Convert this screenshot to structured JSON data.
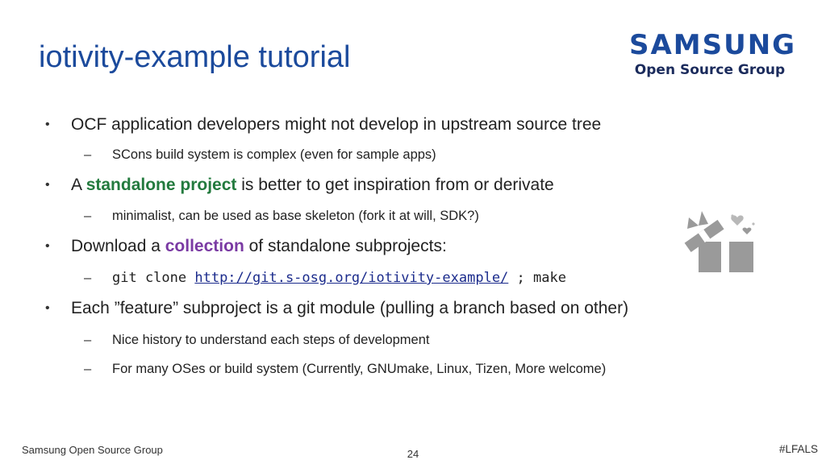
{
  "slide": {
    "title": "iotivity-example tutorial",
    "logo": {
      "wordmark": "SAMSUNG",
      "subtitle": "Open Source Group",
      "brand_color": "#1b4a9c"
    },
    "bullets": [
      {
        "text": "OCF application developers might not develop in upstream source tree",
        "subs": [
          "SCons build system is complex (even for sample apps)"
        ]
      },
      {
        "pre": "A ",
        "highlight": "standalone project",
        "post": " is better to get inspiration from or derivate",
        "highlight_color": "#237a3e",
        "subs": [
          "minimalist, can be used as base skeleton (fork it at will, SDK?)"
        ]
      },
      {
        "pre": "Download a ",
        "highlight": "collection",
        "post": " of standalone subprojects:",
        "highlight_color": "#7a3aa3",
        "command": {
          "pre": "git clone ",
          "link": "http://git.s-osg.org/iotivity-example/",
          "post": " ; make"
        }
      },
      {
        "text": "Each ”feature” subproject is a git module (pulling a branch based on other)",
        "subs": [
          "Nice history to understand each steps of development",
          "For many OSes or build system (Currently, GNUmake, Linux, Tizen, More welcome)"
        ]
      }
    ],
    "bullet_glyph": "•",
    "sub_glyph": "–",
    "decoration_icon": "gift-icon"
  },
  "footer": {
    "left": "Samsung Open Source Group",
    "page": "24",
    "right": "#LFALS"
  }
}
